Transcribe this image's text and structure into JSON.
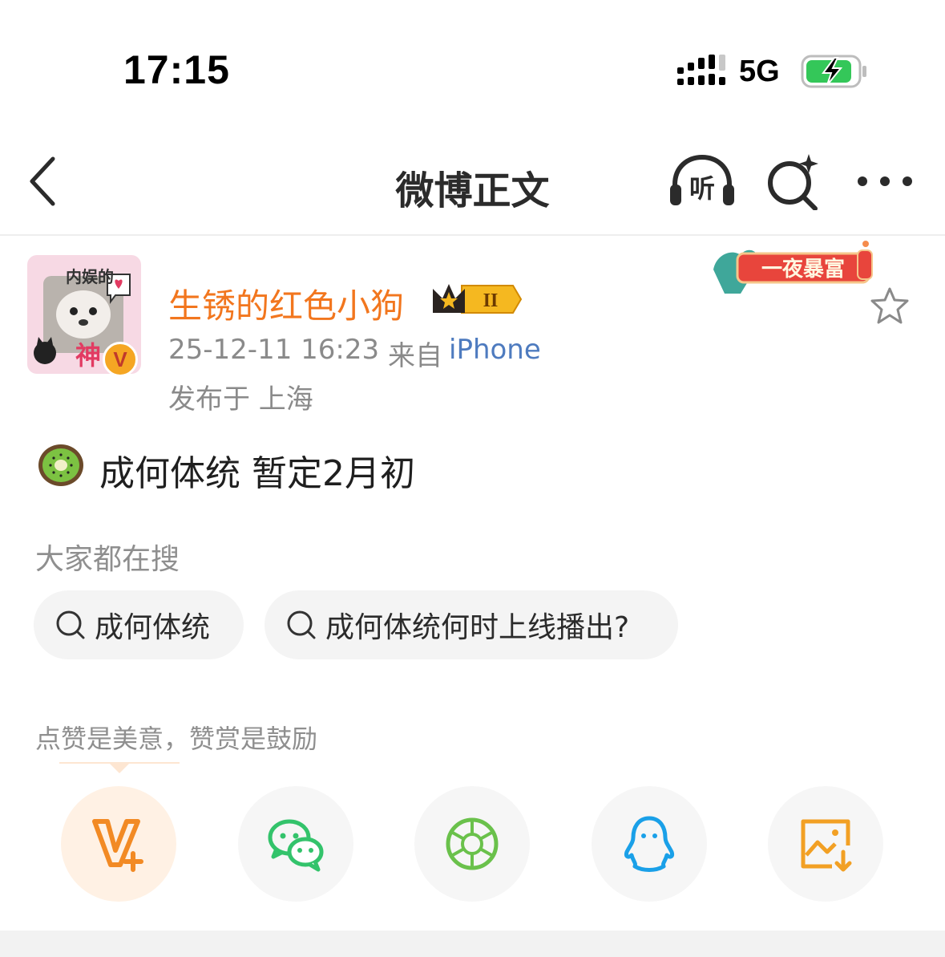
{
  "status_bar": {
    "time": "17:15",
    "network": "5G",
    "icons": [
      "signal-icon",
      "battery-charging-icon"
    ],
    "battery_color": "#34c759"
  },
  "nav": {
    "title": "微博正文",
    "listen_label": "听",
    "icons": [
      "back-arrow-icon",
      "listen-headphone-icon",
      "ai-search-icon",
      "more-icon"
    ]
  },
  "author": {
    "avatar_text_top": "内娱的",
    "avatar_text_bottom": "神",
    "verified_mark": "V",
    "name": "生锈的红色小狗",
    "vip_level": "II",
    "post_time": "25-12-11 16:23",
    "from_label": "来自",
    "source": "iPhone",
    "location": "发布于 上海",
    "name_color": "#f2761e",
    "link_color": "#4e7bbf"
  },
  "decoration": {
    "banner_text": "一夜暴富"
  },
  "post": {
    "emoji": "kiwi-icon",
    "text": "成何体统 暂定2月初"
  },
  "hot_search": {
    "title": "大家都在搜",
    "chips": [
      {
        "label": "成何体统"
      },
      {
        "label": "成何体统何时上线播出?"
      }
    ]
  },
  "reward": {
    "text": "点赞是美意，赞赏是鼓励"
  },
  "share": {
    "buttons": [
      "v-plus-icon",
      "wechat-icon",
      "moments-icon",
      "qq-icon",
      "save-image-icon"
    ]
  }
}
